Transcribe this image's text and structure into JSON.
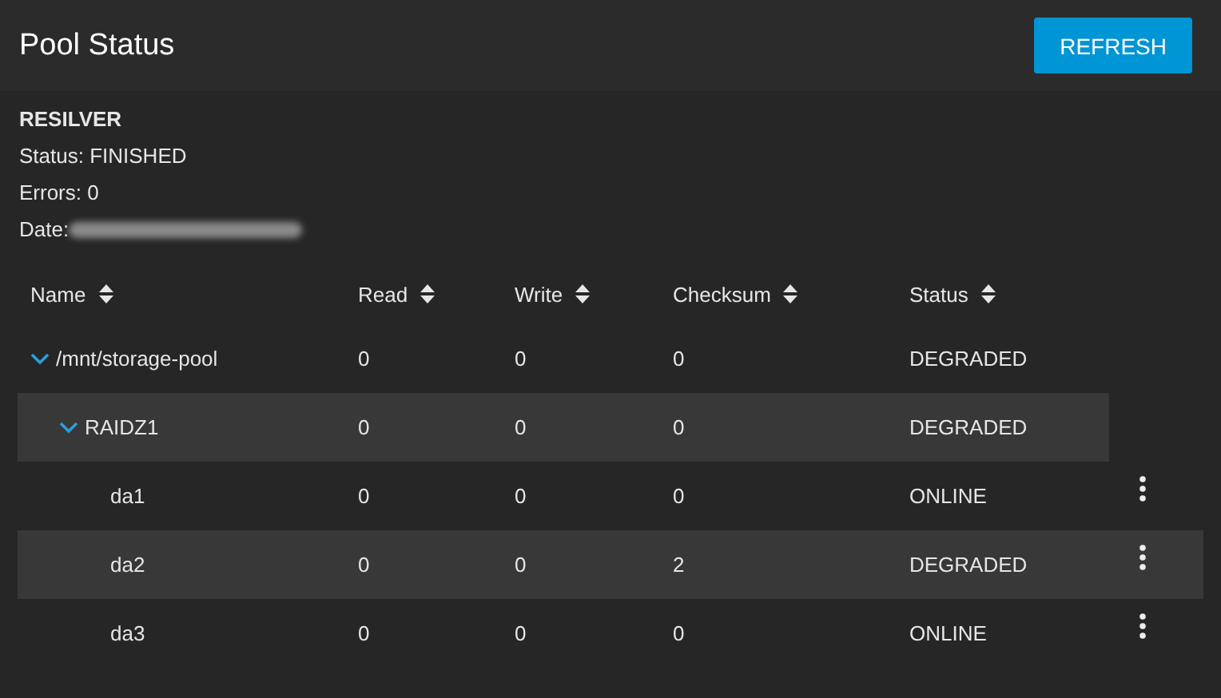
{
  "header": {
    "title": "Pool Status",
    "refresh_button": "REFRESH"
  },
  "scan": {
    "heading": "RESILVER",
    "status": "Status: FINISHED",
    "errors": "Errors: 0",
    "date_label": "Date:"
  },
  "table": {
    "columns": [
      "Name",
      "Read",
      "Write",
      "Checksum",
      "Status"
    ],
    "rows": [
      {
        "kind": "pool",
        "name": "/mnt/storage-pool",
        "read": "0",
        "write": "0",
        "checksum": "0",
        "status": "DEGRADED",
        "expanded": true,
        "highlighted": false,
        "children": [
          {
            "kind": "vdev",
            "name": "RAIDZ1",
            "read": "0",
            "write": "0",
            "checksum": "0",
            "status": "DEGRADED",
            "expanded": true,
            "highlighted": true,
            "children": [
              {
                "kind": "disk",
                "name": "da1",
                "read": "0",
                "write": "0",
                "checksum": "0",
                "status": "ONLINE",
                "highlighted": false
              },
              {
                "kind": "disk",
                "name": "da2",
                "read": "0",
                "write": "0",
                "checksum": "2",
                "status": "DEGRADED",
                "highlighted": true
              },
              {
                "kind": "disk",
                "name": "da3",
                "read": "0",
                "write": "0",
                "checksum": "0",
                "status": "ONLINE",
                "highlighted": false
              }
            ]
          }
        ]
      }
    ]
  }
}
